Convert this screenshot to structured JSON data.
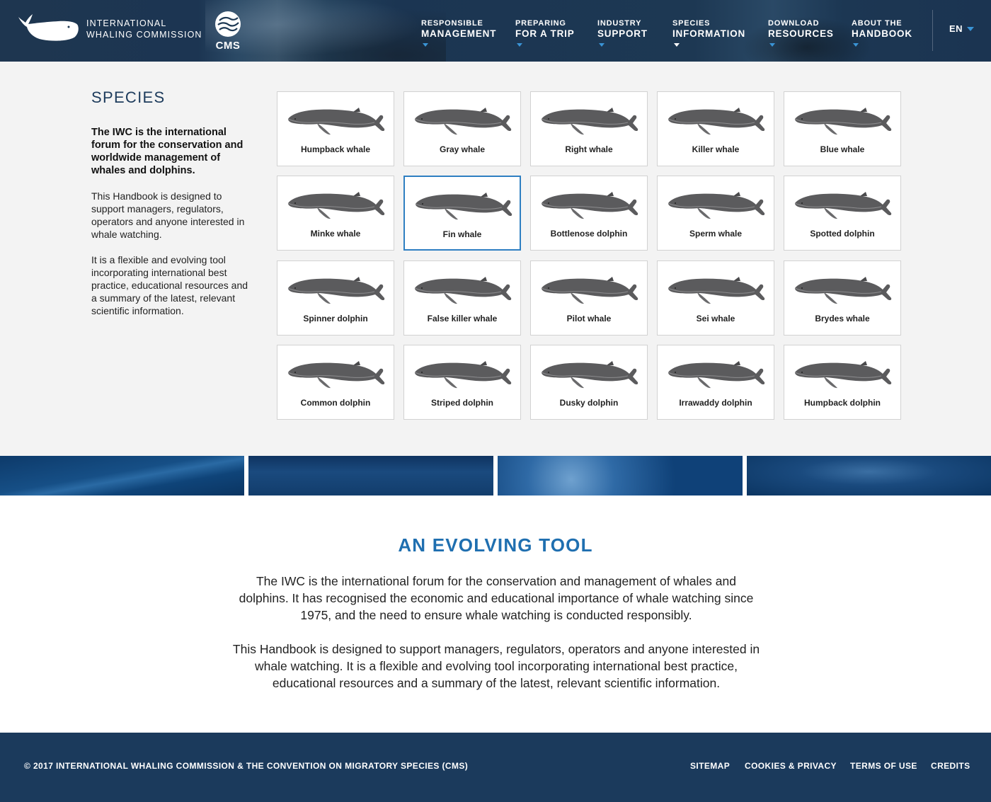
{
  "header": {
    "org_line1": "INTERNATIONAL",
    "org_line2": "WHALING COMMISSION",
    "cms_label": "CMS",
    "nav": [
      {
        "top": "RESPONSIBLE",
        "bottom": "MANAGEMENT"
      },
      {
        "top": "PREPARING",
        "bottom": "FOR A TRIP"
      },
      {
        "top": "INDUSTRY",
        "bottom": "SUPPORT"
      },
      {
        "top": "SPECIES",
        "bottom": "INFORMATION",
        "active": true
      },
      {
        "top": "DOWNLOAD",
        "bottom": "RESOURCES"
      },
      {
        "top": "ABOUT THE",
        "bottom": "HANDBOOK"
      }
    ],
    "language": "EN"
  },
  "species": {
    "title": "SPECIES",
    "lead": "The IWC is the international forum for the conservation and worldwide management of whales and dolphins.",
    "paragraph1": "This Handbook is designed to support managers, regulators, operators and anyone interested in whale watching.",
    "paragraph2": "It is a flexible and evolving tool incorporating international best practice, educational resources and a summary of the latest, relevant scientific information.",
    "items": [
      "Humpback whale",
      "Gray whale",
      "Right whale",
      "Killer whale",
      "Blue whale",
      "Minke whale",
      "Fin whale",
      "Bottlenose dolphin",
      "Sperm whale",
      "Spotted dolphin",
      "Spinner dolphin",
      "False killer whale",
      "Pilot whale",
      "Sei whale",
      "Brydes whale",
      "Common dolphin",
      "Striped dolphin",
      "Dusky dolphin",
      "Irrawaddy dolphin",
      "Humpback dolphin"
    ],
    "selected": "Fin whale"
  },
  "evolving": {
    "title": "AN EVOLVING TOOL",
    "paragraph1": "The IWC is the international forum for the conservation and management of whales and dolphins. It has recognised the economic and educational importance of whale watching since 1975, and the need to ensure whale watching is conducted responsibly.",
    "paragraph2": "This Handbook is designed to support managers, regulators, operators and anyone interested in whale watching. It is a flexible and evolving tool incorporating international best practice, educational resources and a summary of the latest, relevant scientific information."
  },
  "footer": {
    "copyright": "© 2017 INTERNATIONAL WHALING COMMISSION & THE CONVENTION ON MIGRATORY SPECIES (CMS)",
    "links": [
      "SITEMAP",
      "COOKIES & PRIVACY",
      "TERMS OF USE",
      "CREDITS"
    ]
  },
  "colors": {
    "header_bg": "#1d3853",
    "accent_blue": "#1f6fb0",
    "nav_caret": "#3a94d6",
    "title_navy": "#1d3b5c",
    "footer_bg": "#1b3a5c",
    "panel_bg": "#f3f3f3",
    "selected_border": "#2e7fc2"
  }
}
